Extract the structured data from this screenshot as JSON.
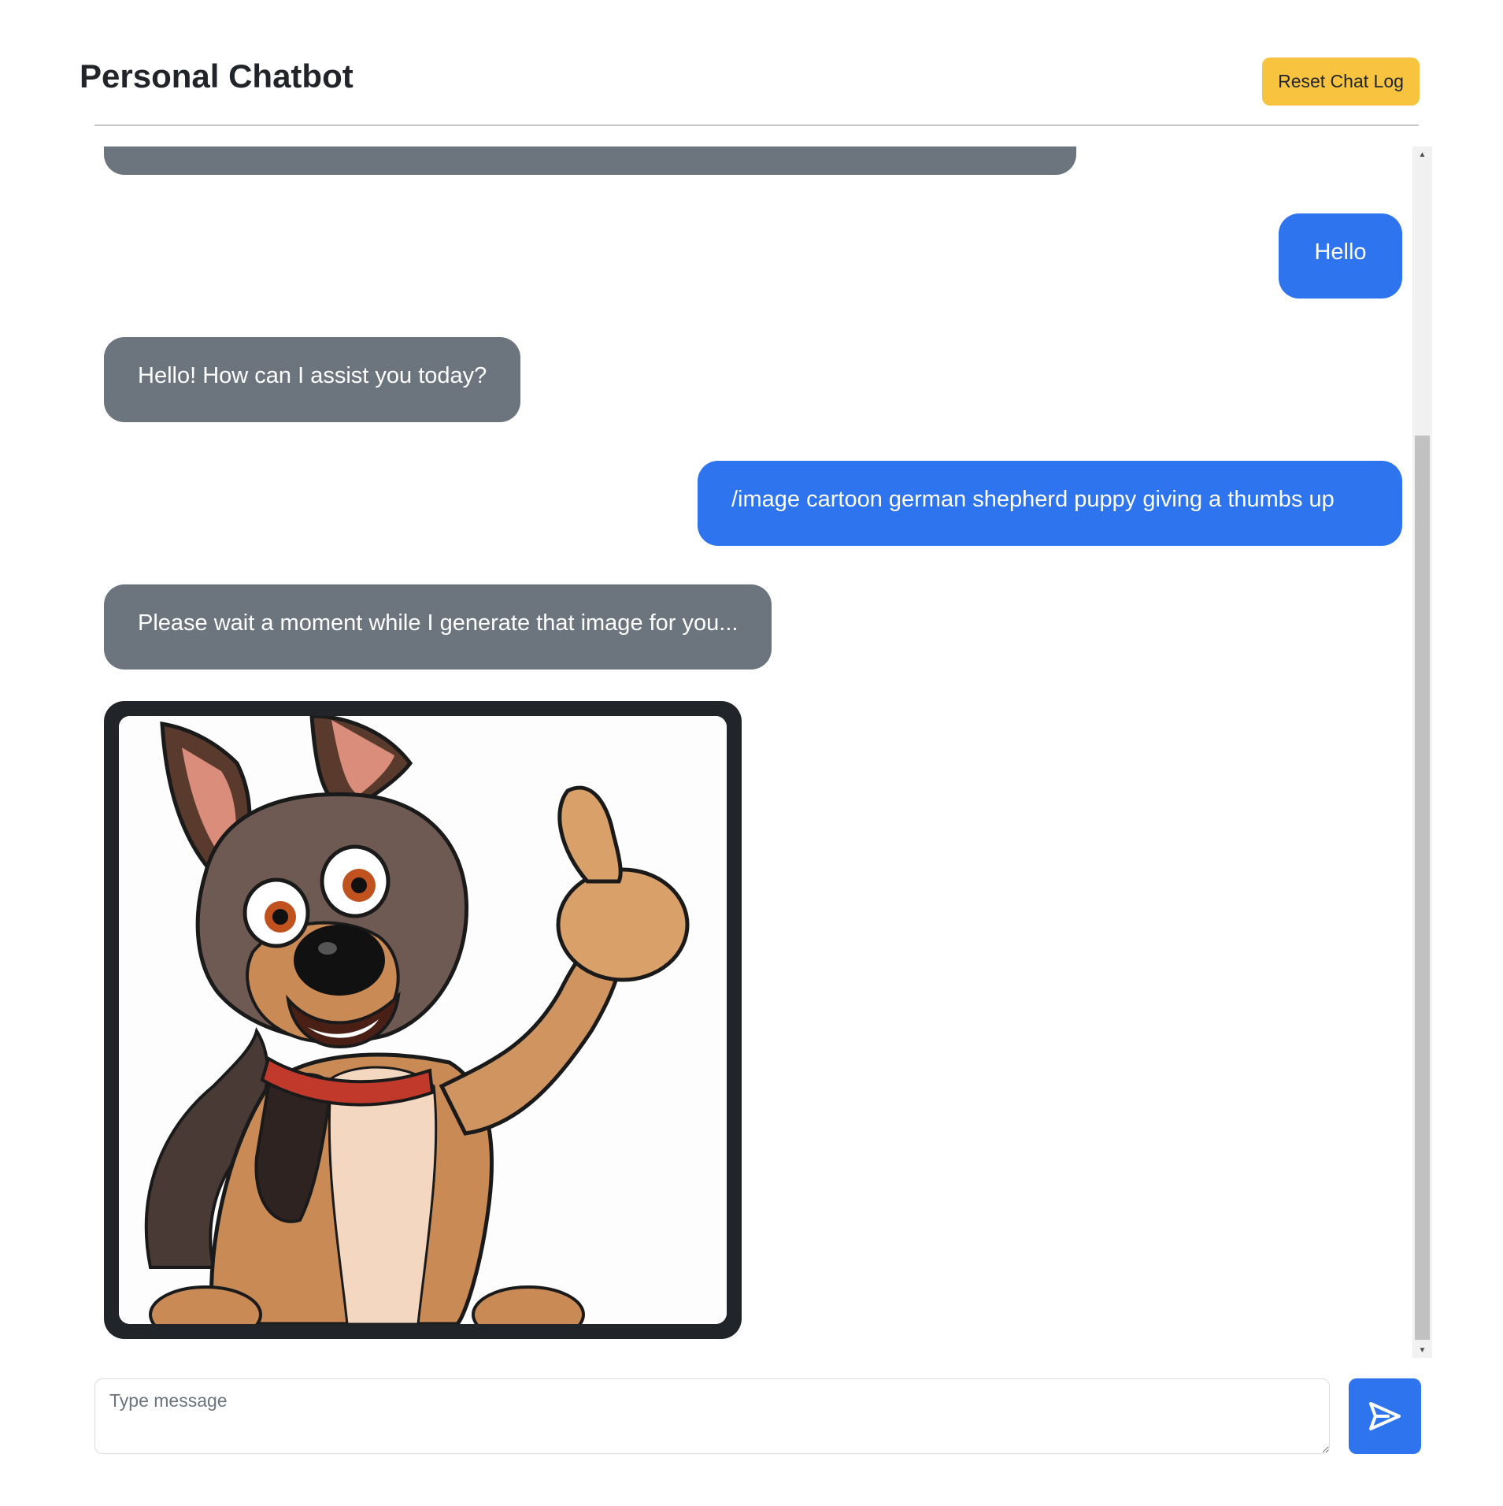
{
  "header": {
    "title": "Personal Chatbot",
    "reset_label": "Reset Chat Log"
  },
  "messages": [
    {
      "role": "bot",
      "text": ""
    },
    {
      "role": "user",
      "text": "Hello"
    },
    {
      "role": "bot",
      "text": "Hello! How can I assist you today?"
    },
    {
      "role": "user",
      "text": "/image cartoon german shepherd puppy giving a thumbs up"
    },
    {
      "role": "bot",
      "text": "Please wait a moment while I generate that image for you..."
    },
    {
      "role": "bot",
      "type": "image",
      "content": "cartoon german shepherd puppy giving a thumbs up"
    }
  ],
  "composer": {
    "placeholder": "Type message",
    "value": ""
  },
  "icons": {
    "send": "send-icon",
    "scroll_up": "scroll-up-arrow-icon",
    "scroll_down": "scroll-down-arrow-icon"
  },
  "colors": {
    "user_bubble": "#2d74ee",
    "bot_bubble": "#6c757d",
    "reset_button": "#f8c43f",
    "send_button": "#2d74ee",
    "image_frame": "#212529"
  }
}
